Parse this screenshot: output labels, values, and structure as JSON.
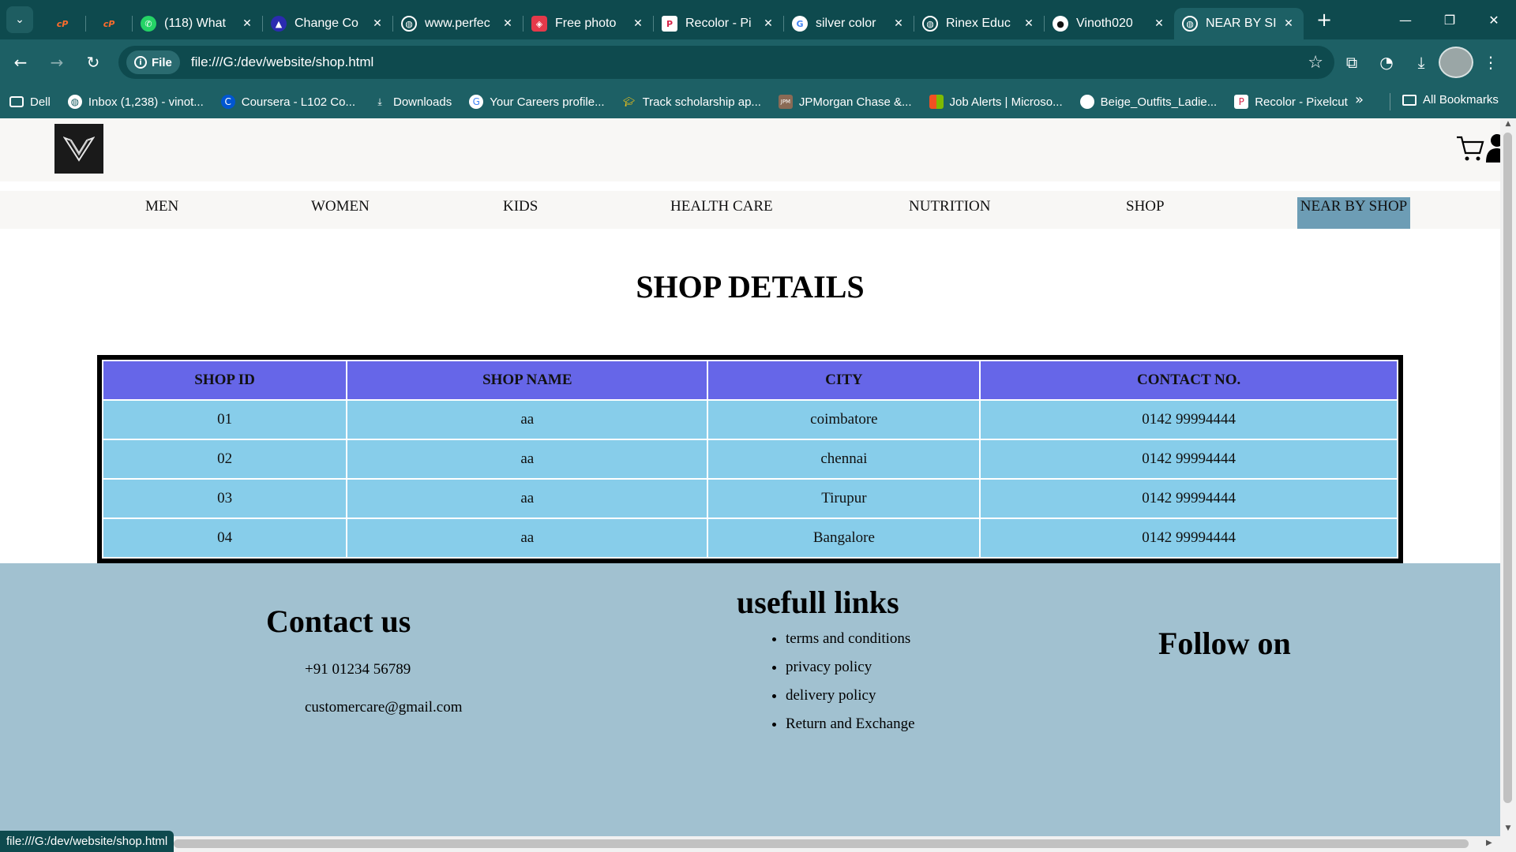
{
  "browser": {
    "tabs": [
      {
        "title": "",
        "favicon": "cpanel-icon",
        "pinned": true
      },
      {
        "title": "",
        "favicon": "cpanel-icon",
        "pinned": true
      },
      {
        "title": "(118) What",
        "favicon": "whatsapp-icon"
      },
      {
        "title": "Change Co",
        "favicon": "figma-icon"
      },
      {
        "title": "www.perfec",
        "favicon": "globe-icon"
      },
      {
        "title": "Free photo",
        "favicon": "photo-editor-icon"
      },
      {
        "title": "Recolor - Pi",
        "favicon": "pixelcut-icon"
      },
      {
        "title": "silver color",
        "favicon": "google-icon"
      },
      {
        "title": "Rinex Educ",
        "favicon": "globe-icon"
      },
      {
        "title": "Vinoth020",
        "favicon": "github-icon"
      },
      {
        "title": "NEAR BY SI",
        "favicon": "globe-icon",
        "active": true
      }
    ],
    "address": {
      "chip_label": "File",
      "url": "file:///G:/dev/website/shop.html"
    },
    "bookmarks": [
      {
        "label": "Dell",
        "icon": "folder-icon"
      },
      {
        "label": "Inbox (1,238) - vinot...",
        "icon": "globe-icon"
      },
      {
        "label": "Coursera - L102 Co...",
        "icon": "coursera-icon"
      },
      {
        "label": "Downloads",
        "icon": "download-icon"
      },
      {
        "label": "Your Careers profile...",
        "icon": "google-icon"
      },
      {
        "label": "Track scholarship ap...",
        "icon": "graduation-icon"
      },
      {
        "label": "JPMorgan Chase &...",
        "icon": "jpmc-icon"
      },
      {
        "label": "Job Alerts | Microso...",
        "icon": "microsoft-icon"
      },
      {
        "label": "Beige_Outfits_Ladie...",
        "icon": "circle-icon"
      },
      {
        "label": "Recolor - Pixelcut",
        "icon": "pixelcut-icon"
      }
    ],
    "bookmarks_overflow": "»",
    "all_bookmarks": "All Bookmarks",
    "status_url": "file:///G:/dev/website/shop.html"
  },
  "site": {
    "nav": [
      "MEN",
      "WOMEN",
      "KIDS",
      "HEALTH CARE",
      "NUTRITION",
      "SHOP",
      "NEAR BY SHOP"
    ],
    "active_nav": "NEAR BY SHOP",
    "page_title": "SHOP DETAILS",
    "table": {
      "headers": [
        "SHOP ID",
        "SHOP NAME",
        "CITY",
        "CONTACT NO."
      ],
      "rows": [
        [
          "01",
          "aa",
          "coimbatore",
          "0142 99994444"
        ],
        [
          "02",
          "aa",
          "chennai",
          "0142 99994444"
        ],
        [
          "03",
          "aa",
          "Tirupur",
          "0142 99994444"
        ],
        [
          "04",
          "aa",
          "Bangalore",
          "0142 99994444"
        ]
      ]
    },
    "footer": {
      "contact_title": "Contact us",
      "phone": "+91 01234 56789",
      "email": "customercare@gmail.com",
      "links_title": "usefull links",
      "links": [
        "terms and conditions",
        "privacy policy",
        "delivery policy",
        "Return and Exchange"
      ],
      "follow_title": "Follow on"
    }
  },
  "colors": {
    "chrome_dark": "#0e4a4e",
    "chrome": "#1d6065",
    "table_header": "#6666e8",
    "table_cell": "#87cdea",
    "footer_bg": "#a1c1d0",
    "active_nav": "#6d9db5"
  }
}
